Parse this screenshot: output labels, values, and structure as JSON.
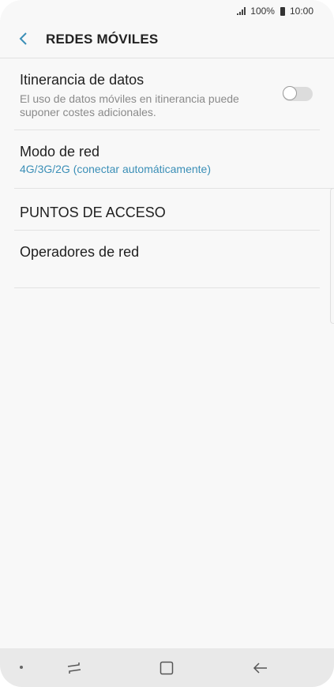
{
  "status_bar": {
    "battery": "100%",
    "time": "10:00"
  },
  "header": {
    "title": "REDES MÓVILES",
    "back_icon": "chevron-left-icon"
  },
  "settings": {
    "roaming": {
      "title": "Itinerancia de datos",
      "subtitle": "El uso de datos móviles en itinerancia puede suponer costes adicionales.",
      "toggle_on": false
    },
    "network_mode": {
      "title": "Modo de red",
      "value": "4G/3G/2G (conectar automáticamente)"
    },
    "apn": {
      "title": "PUNTOS DE ACCESO"
    },
    "operators": {
      "title": "Operadores de red"
    }
  },
  "colors": {
    "accent": "#3b8fb7",
    "background": "#f8f8f8",
    "nav_bar": "#e9e9e9"
  },
  "nav_bar": {
    "icons": [
      "dot-icon",
      "recent-apps-icon",
      "home-icon",
      "back-arrow-icon"
    ]
  }
}
